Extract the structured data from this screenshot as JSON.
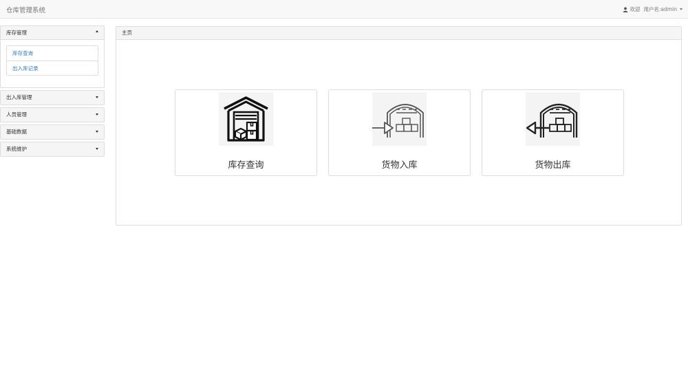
{
  "app": {
    "title": "仓库管理系统"
  },
  "user": {
    "welcome": "欢迎",
    "username_label": "用户名:admin"
  },
  "sidebar": {
    "groups": [
      {
        "label": "库存管理",
        "expanded": true,
        "items": [
          {
            "label": "库存查询"
          },
          {
            "label": "出入库记录"
          }
        ]
      },
      {
        "label": "出入库管理",
        "expanded": false
      },
      {
        "label": "人员管理",
        "expanded": false
      },
      {
        "label": "基础数据",
        "expanded": false
      },
      {
        "label": "系统维护",
        "expanded": false
      }
    ]
  },
  "main": {
    "heading": "主页",
    "tiles": [
      {
        "label": "库存查询",
        "icon": "warehouse-icon"
      },
      {
        "label": "货物入库",
        "icon": "warehouse-inbound-icon"
      },
      {
        "label": "货物出库",
        "icon": "warehouse-outbound-icon"
      }
    ]
  },
  "colors": {
    "link": "#337ab7",
    "navbar_bg": "#f8f8f8",
    "panel_heading_bg": "#f5f5f5",
    "border": "#dddddd"
  }
}
